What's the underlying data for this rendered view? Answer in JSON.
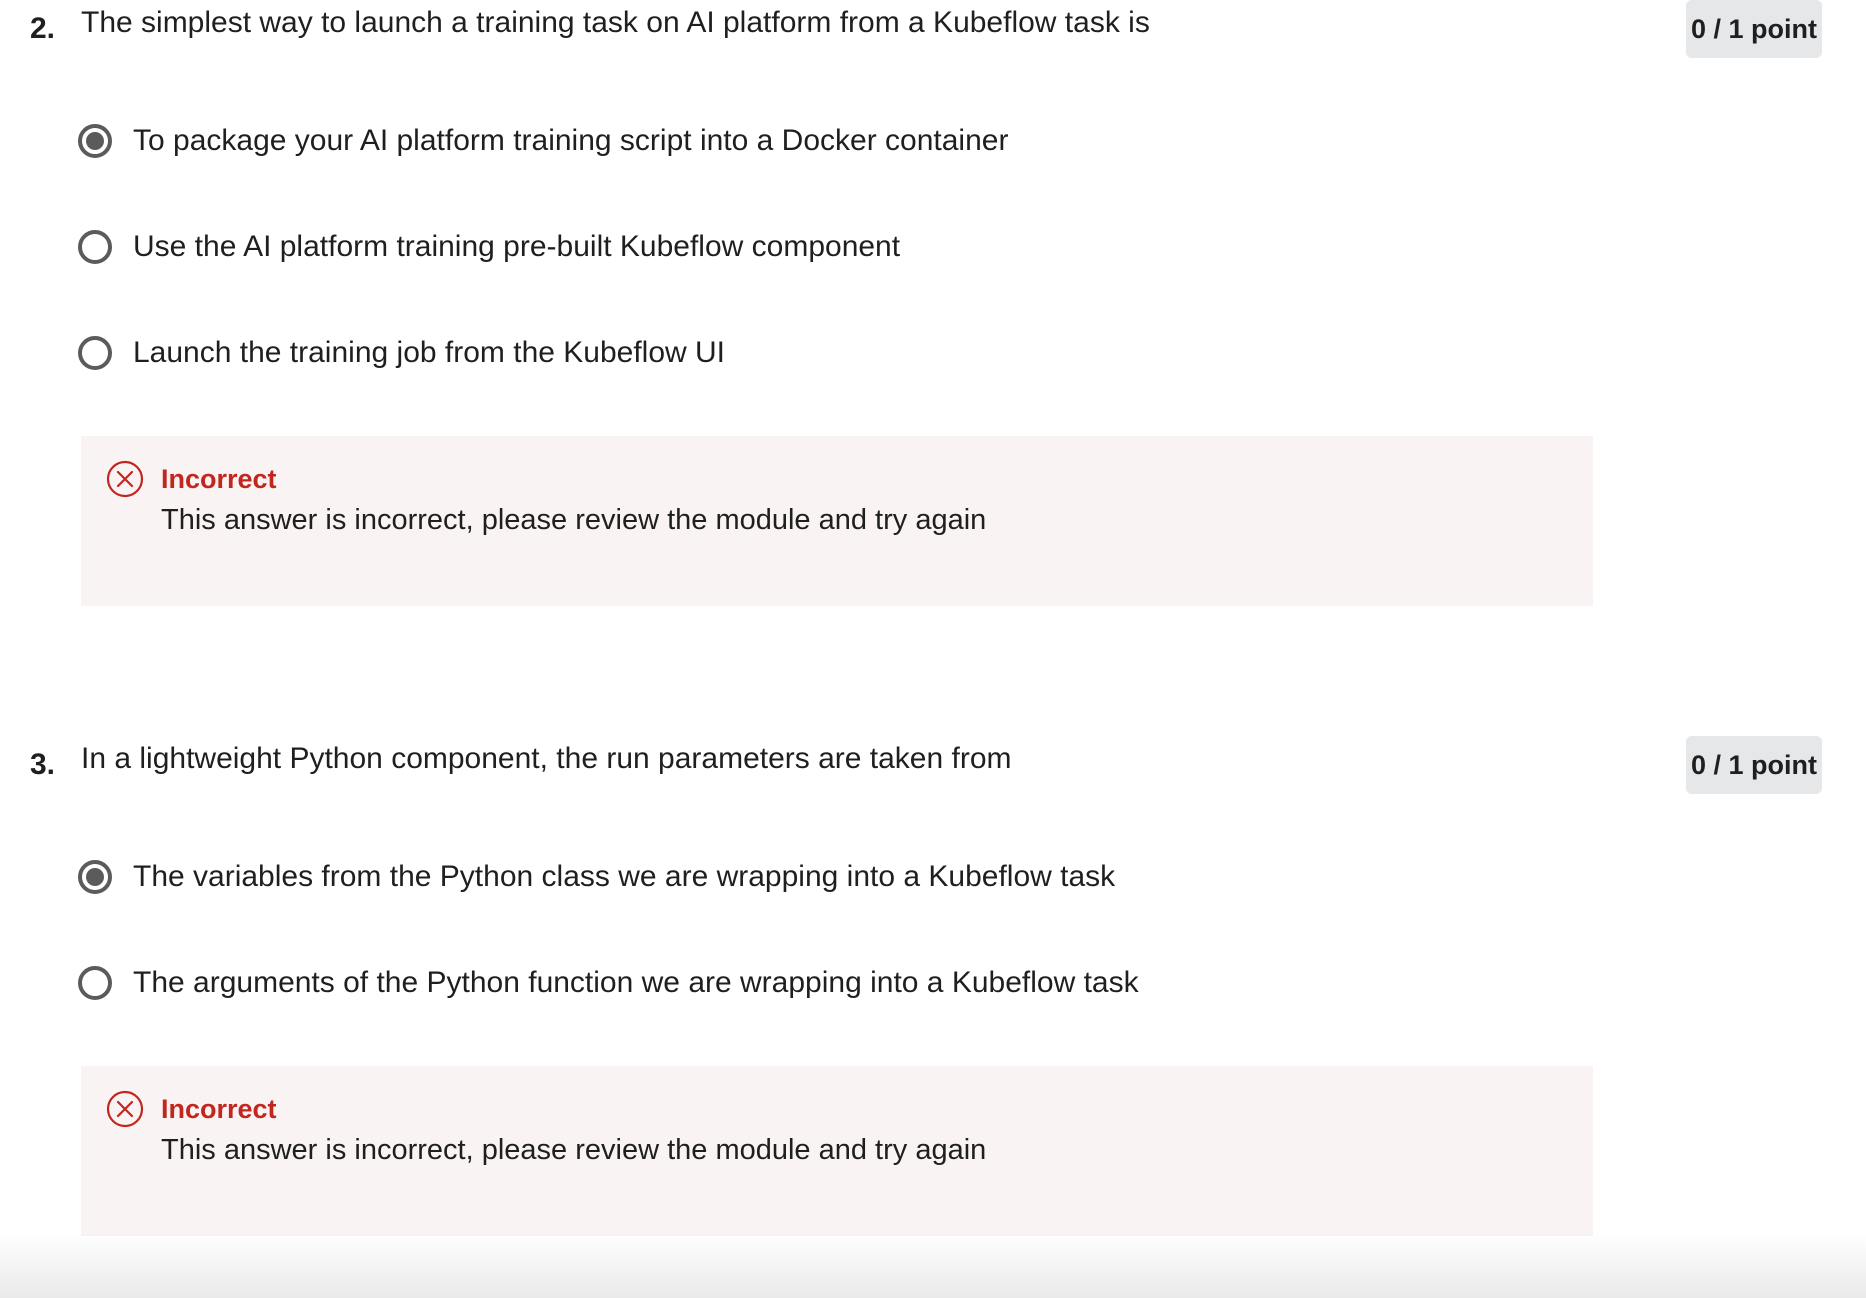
{
  "questions": [
    {
      "number": "2.",
      "text": "The simplest way to launch a training task on AI platform from a Kubeflow task is",
      "points": "0 / 1 point",
      "options": [
        {
          "label": "To package your AI platform training script into a Docker container",
          "selected": true
        },
        {
          "label": "Use the AI platform training pre-built Kubeflow component",
          "selected": false
        },
        {
          "label": "Launch the training job from the Kubeflow UI",
          "selected": false
        }
      ],
      "feedback": {
        "status": "Incorrect",
        "message": "This answer is incorrect, please review the module and try again",
        "icon": "x-circle-icon"
      }
    },
    {
      "number": "3.",
      "text": "In a lightweight Python component, the run parameters are taken from",
      "points": "0 / 1 point",
      "options": [
        {
          "label": "The variables from the Python class we are wrapping into a Kubeflow task",
          "selected": true
        },
        {
          "label": "The arguments of the Python function we are wrapping into a Kubeflow task",
          "selected": false
        }
      ],
      "feedback": {
        "status": "Incorrect",
        "message": "This answer is incorrect, please review the module and try again",
        "icon": "x-circle-icon"
      }
    }
  ],
  "colors": {
    "error": "#c1271e",
    "feedback_bg": "#f9f3f3",
    "badge_bg": "#e5e7e8",
    "radio": "#5b5b5b"
  }
}
